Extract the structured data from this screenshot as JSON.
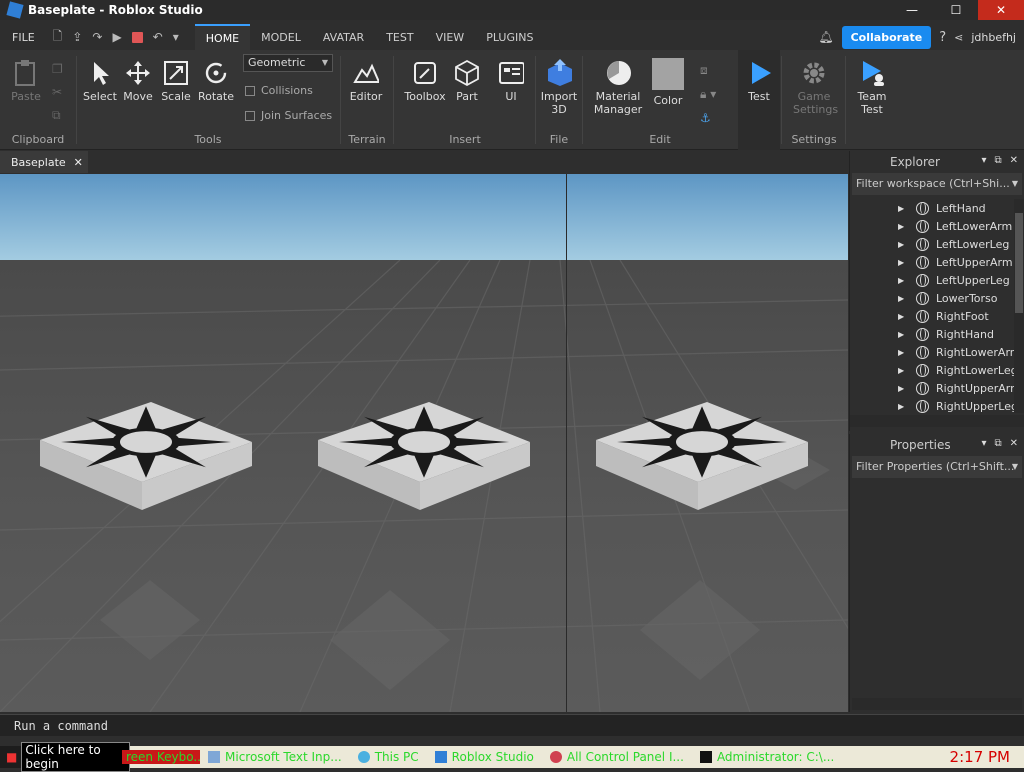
{
  "window": {
    "title": "Baseplate - Roblox Studio",
    "min": "—",
    "max": "☐",
    "close": "✕"
  },
  "menubar": {
    "file": "FILE",
    "tabs": [
      "HOME",
      "MODEL",
      "AVATAR",
      "TEST",
      "VIEW",
      "PLUGINS"
    ],
    "collaborate": "Collaborate",
    "user": "jdhbefhj"
  },
  "ribbon": {
    "clipboard": {
      "paste": "Paste",
      "label": "Clipboard"
    },
    "tools": {
      "select": "Select",
      "move": "Move",
      "scale": "Scale",
      "rotate": "Rotate",
      "mode": "Geometric",
      "collisions": "Collisions",
      "join": "Join Surfaces",
      "label": "Tools"
    },
    "terrain": {
      "editor": "Editor",
      "label": "Terrain"
    },
    "insert": {
      "toolbox": "Toolbox",
      "part": "Part",
      "ui": "UI",
      "label": "Insert"
    },
    "file": {
      "import_a": "Import",
      "import_b": "3D",
      "label": "File"
    },
    "edit": {
      "material_a": "Material",
      "material_b": "Manager",
      "color": "Color",
      "label": "Edit"
    },
    "test": {
      "test": "Test"
    },
    "settings": {
      "game_a": "Game",
      "game_b": "Settings",
      "label": "Settings"
    },
    "team": {
      "team_a": "Team",
      "team_b": "Test"
    }
  },
  "doctab": {
    "label": "Baseplate",
    "close": "✕"
  },
  "explorer": {
    "title": "Explorer",
    "filter": "Filter workspace (Ctrl+Shi...",
    "items": [
      "LeftHand",
      "LeftLowerArm",
      "LeftLowerLeg",
      "LeftUpperArm",
      "LeftUpperLeg",
      "LowerTorso",
      "RightFoot",
      "RightHand",
      "RightLowerArm",
      "RightLowerLeg",
      "RightUpperArm",
      "RightUpperLeg"
    ]
  },
  "properties": {
    "title": "Properties",
    "filter": "Filter Properties (Ctrl+Shift..."
  },
  "command": {
    "placeholder": "Run a command"
  },
  "taskbar": {
    "begin": "Click here to begin",
    "items": [
      "reen Keybo...",
      "Microsoft Text Inp...",
      "This PC",
      "Roblox Studio",
      "All Control Panel I...",
      "Administrator: C:\\..."
    ],
    "clock": "2:17 PM"
  },
  "colors": {
    "accent": "#3aa0ff",
    "collaborate": "#1a8bf0",
    "sky": "#8fc0de",
    "pad": "#d6d6d6"
  }
}
